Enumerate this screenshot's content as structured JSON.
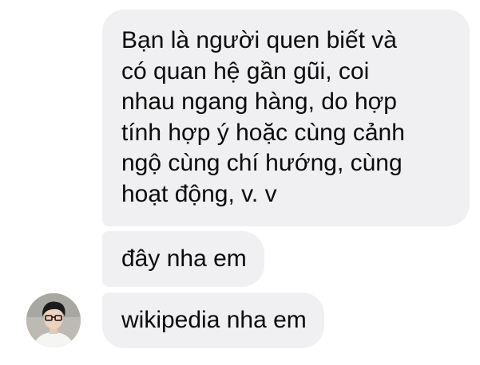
{
  "messages": [
    {
      "lines": [
        "Bạn là người quen biết và",
        "có quan hệ gần gũi, coi",
        "nhau ngang hàng, do hợp",
        "tính hợp ý hoặc cùng cảnh",
        "ngộ cùng chí hướng, cùng",
        "hoạt động, v. v"
      ]
    },
    {
      "text": "đây nha em"
    },
    {
      "text": "wikipedia nha em"
    }
  ],
  "colors": {
    "bubble_background": "#f0f0f2",
    "text": "#0a0a0a",
    "page_background": "#ffffff"
  },
  "sender": {
    "avatar_icon": "profile-photo-avatar"
  }
}
